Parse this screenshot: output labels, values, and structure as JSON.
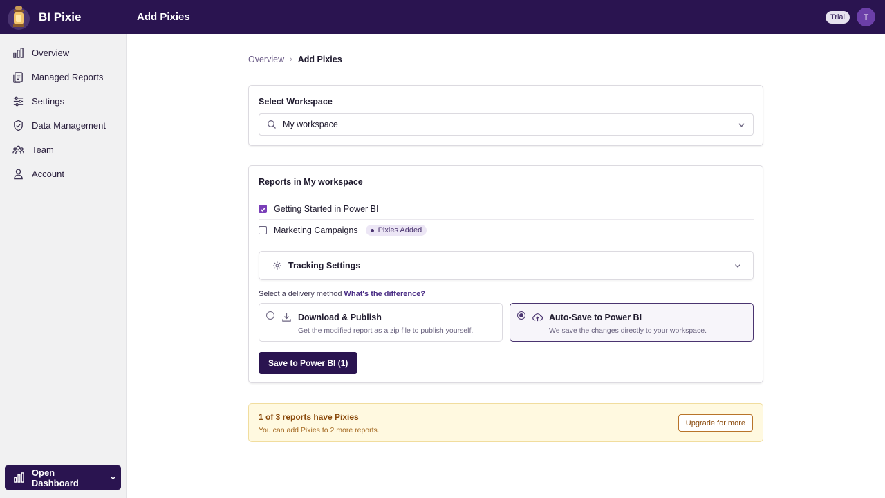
{
  "app": {
    "name": "BI Pixie",
    "page_title": "Add Pixies",
    "trial_label": "Trial",
    "avatar_initial": "T"
  },
  "sidebar": {
    "items": [
      {
        "label": "Overview",
        "icon": "bar-chart-icon"
      },
      {
        "label": "Managed Reports",
        "icon": "report-icon"
      },
      {
        "label": "Settings",
        "icon": "sliders-icon"
      },
      {
        "label": "Data Management",
        "icon": "shield-icon"
      },
      {
        "label": "Team",
        "icon": "team-icon"
      },
      {
        "label": "Account",
        "icon": "user-icon"
      }
    ],
    "open_dashboard_label": "Open Dashboard"
  },
  "breadcrumb": {
    "parent": "Overview",
    "current": "Add Pixies"
  },
  "workspace": {
    "label": "Select Workspace",
    "selected": "My workspace"
  },
  "reports": {
    "heading": "Reports in My workspace",
    "items": [
      {
        "name": "Getting Started in Power BI",
        "checked": true,
        "badge": ""
      },
      {
        "name": "Marketing Campaigns",
        "checked": false,
        "badge": "Pixies Added"
      }
    ],
    "tracking_label": "Tracking Settings",
    "delivery_prompt": "Select a delivery method",
    "delivery_link": "What's the difference?",
    "options": [
      {
        "title": "Download & Publish",
        "desc": "Get the modified report as a zip file to publish yourself.",
        "selected": false
      },
      {
        "title": "Auto-Save to Power BI",
        "desc": "We save the changes directly to your workspace.",
        "selected": true
      }
    ],
    "save_label": "Save to Power BI (1)"
  },
  "banner": {
    "title": "1 of 3 reports have Pixies",
    "subtitle": "You can add Pixies to 2 more reports.",
    "button": "Upgrade for more"
  },
  "colors": {
    "brand": "#2a1450",
    "accent": "#7a3fb8",
    "warning_bg": "#fff9e0",
    "warning_text": "#8a4a0c"
  }
}
